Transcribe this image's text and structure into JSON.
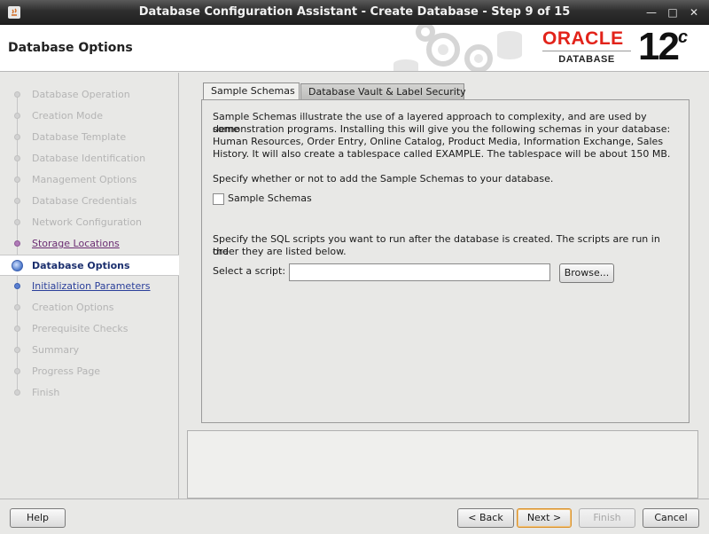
{
  "window": {
    "title": "Database Configuration Assistant - Create Database - Step 9 of 15",
    "minimize_glyph": "—",
    "maximize_glyph": "□",
    "close_glyph": "✕"
  },
  "header": {
    "page_title": "Database Options",
    "logo_brand": "ORACLE",
    "logo_product": "DATABASE",
    "logo_version": "12",
    "logo_version_suffix": "c"
  },
  "steps": [
    {
      "label": "Database Operation",
      "state": "disabled"
    },
    {
      "label": "Creation Mode",
      "state": "disabled"
    },
    {
      "label": "Database Template",
      "state": "disabled"
    },
    {
      "label": "Database Identification",
      "state": "disabled"
    },
    {
      "label": "Management Options",
      "state": "disabled"
    },
    {
      "label": "Database Credentials",
      "state": "disabled"
    },
    {
      "label": "Network Configuration",
      "state": "disabled"
    },
    {
      "label": "Storage Locations",
      "state": "visited"
    },
    {
      "label": "Database Options",
      "state": "current"
    },
    {
      "label": "Initialization Parameters",
      "state": "link"
    },
    {
      "label": "Creation Options",
      "state": "disabled"
    },
    {
      "label": "Prerequisite Checks",
      "state": "disabled"
    },
    {
      "label": "Summary",
      "state": "disabled"
    },
    {
      "label": "Progress Page",
      "state": "disabled"
    },
    {
      "label": "Finish",
      "state": "disabled"
    }
  ],
  "tabs": [
    {
      "label": "Sample Schemas",
      "active": true
    },
    {
      "label": "Database Vault & Label Security",
      "active": false
    }
  ],
  "sample_schemas": {
    "description_lines": [
      "Sample Schemas illustrate the use of a layered approach to complexity, and are used by some",
      "demonstration programs. Installing this will give you the following schemas in your database:",
      "Human Resources, Order Entry, Online Catalog, Product Media, Information Exchange, Sales",
      "History. It will also create a tablespace called EXAMPLE. The tablespace will be about 150 MB."
    ],
    "prompt": "Specify whether or not to add the Sample Schemas to your database.",
    "checkbox_label": "Sample Schemas",
    "checkbox_checked": false,
    "scripts_lines": [
      "Specify the SQL scripts you want to run after the database is created. The scripts are run in the",
      "order they are listed below."
    ],
    "script_label": "Select a script:",
    "script_value": "",
    "browse_label": "Browse..."
  },
  "footer": {
    "help_label": "Help",
    "back_label": "< Back",
    "next_label": "Next >",
    "finish_label": "Finish",
    "cancel_label": "Cancel"
  },
  "colors": {
    "accent": "#e2231a",
    "current_step": "#1b2f6e",
    "visited_step": "#6b2d72",
    "link_step": "#2a3f9a"
  }
}
